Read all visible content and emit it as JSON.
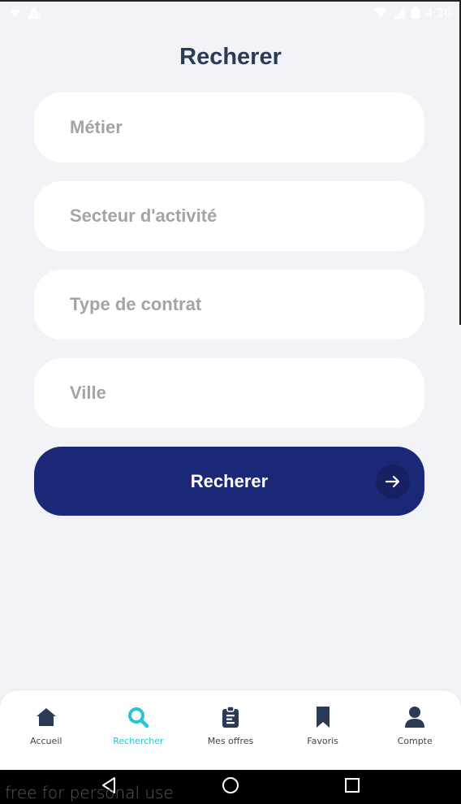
{
  "status_bar": {
    "time": "4:20"
  },
  "page": {
    "title": "Recherer"
  },
  "form": {
    "fields": [
      {
        "placeholder": "Métier",
        "value": ""
      },
      {
        "placeholder": "Secteur d'activité",
        "value": ""
      },
      {
        "placeholder": "Type de contrat",
        "value": ""
      },
      {
        "placeholder": "Ville",
        "value": ""
      }
    ],
    "submit_label": "Recherer",
    "submit_icon": "arrow-right-icon"
  },
  "bottom_nav": {
    "active": "Rechercher",
    "active_color": "#27c4d3",
    "items": [
      {
        "label": "Accueil",
        "icon": "home-icon"
      },
      {
        "label": "Rechercher",
        "icon": "search-icon"
      },
      {
        "label": "Mes offres",
        "icon": "clipboard-icon"
      },
      {
        "label": "Favoris",
        "icon": "bookmark-icon"
      },
      {
        "label": "Compte",
        "icon": "user-icon"
      }
    ]
  },
  "android_nav": {
    "buttons": [
      "back-icon",
      "home-circle-icon",
      "recents-icon"
    ]
  },
  "watermark": "free for personal use",
  "colors": {
    "background": "#f2f3f7",
    "title": "#2b3a55",
    "primary_button": "#1b2877",
    "placeholder": "#a4a4a8"
  }
}
